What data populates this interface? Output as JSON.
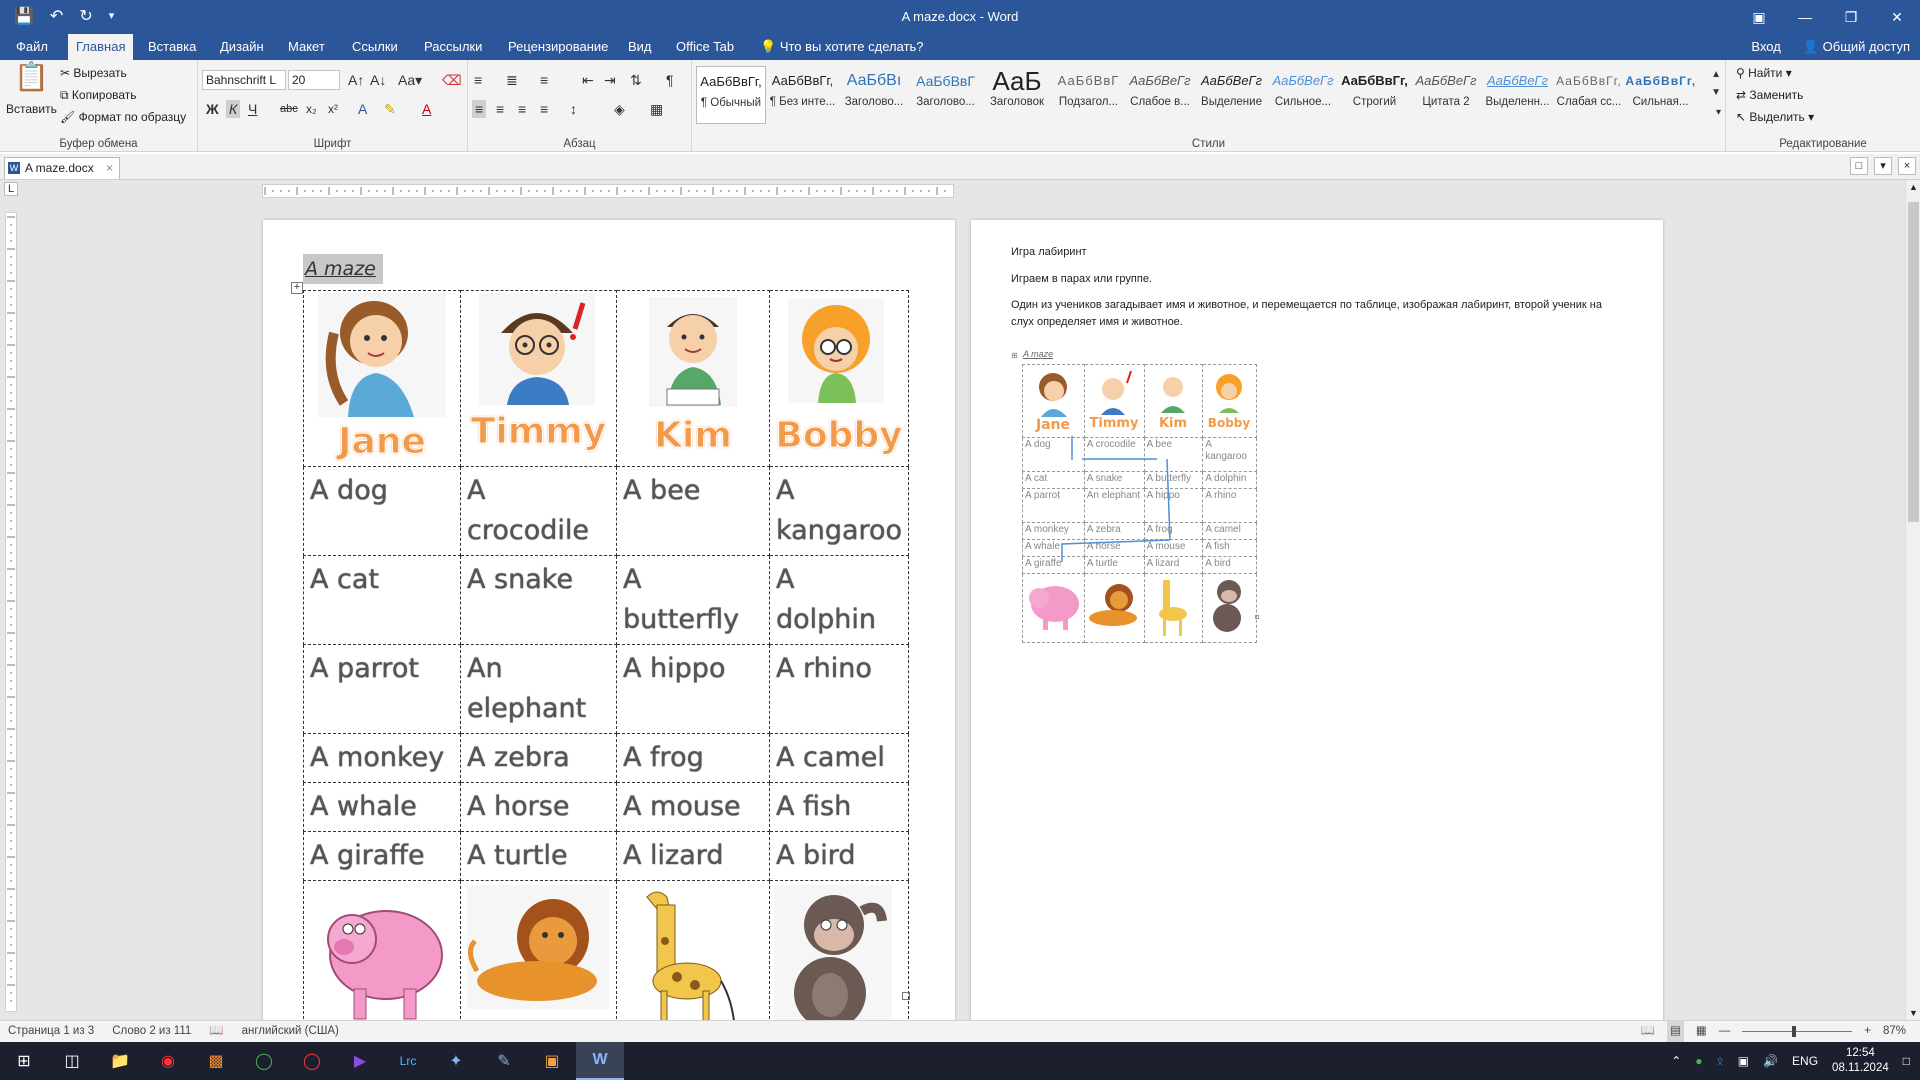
{
  "titlebar": {
    "title": "A maze.docx - Word",
    "qat": [
      "save-icon",
      "undo-icon",
      "redo-icon",
      "customize-icon"
    ]
  },
  "tabs": [
    "Файл",
    "Главная",
    "Вставка",
    "Дизайн",
    "Макет",
    "Ссылки",
    "Рассылки",
    "Рецензирование",
    "Вид",
    "Office Tab"
  ],
  "active_tab": "Главная",
  "tell_me": "Что вы хотите сделать?",
  "account": {
    "signin": "Вход",
    "share": "Общий доступ"
  },
  "ribbon": {
    "clipboard": {
      "paste": "Вставить",
      "cut": "Вырезать",
      "copy": "Копировать",
      "format_painter": "Формат по образцу",
      "label": "Буфер обмена"
    },
    "font": {
      "name": "Bahnschrift L",
      "size": "20",
      "label": "Шрифт"
    },
    "paragraph": {
      "label": "Абзац"
    },
    "styles": {
      "label": "Стили",
      "items": [
        {
          "preview": "АаБбВвГг,",
          "name": "¶ Обычный"
        },
        {
          "preview": "АаБбВвГг,",
          "name": "¶ Без инте..."
        },
        {
          "preview": "АаБбВı",
          "name": "Заголово..."
        },
        {
          "preview": "АаБбВвГ",
          "name": "Заголово..."
        },
        {
          "preview": "АаБ",
          "name": "Заголовок"
        },
        {
          "preview": "АаБбВвГ",
          "name": "Подзагол..."
        },
        {
          "preview": "АаБбВеГг",
          "name": "Слабое в..."
        },
        {
          "preview": "АаБбВеГг",
          "name": "Выделение"
        },
        {
          "preview": "АаБбВеГг",
          "name": "Сильное..."
        },
        {
          "preview": "АаБбВвГг,",
          "name": "Строгий"
        },
        {
          "preview": "АаБбВеГг",
          "name": "Цитата 2"
        },
        {
          "preview": "АаБбВеГг",
          "name": "Выделенн..."
        },
        {
          "preview": "АаБбВвГг,",
          "name": "Слабая сс..."
        },
        {
          "preview": "АаБбВвГг,",
          "name": "Сильная..."
        }
      ]
    },
    "editing": {
      "find": "Найти",
      "replace": "Заменить",
      "select": "Выделить",
      "label": "Редактирование"
    }
  },
  "doc_tab": "A maze.docx",
  "page1": {
    "heading": "A maze",
    "names": [
      "Jane",
      "Timmy",
      "Kim",
      "Bobby"
    ],
    "rows": [
      [
        "A dog",
        "A crocodile",
        "A bee",
        "A kangaroo"
      ],
      [
        "A cat",
        "A snake",
        "A butterfly",
        "A dolphin"
      ],
      [
        "A parrot",
        "An elephant",
        "A hippo",
        "A rhino"
      ],
      [
        "A monkey",
        "A zebra",
        "A frog",
        "A camel"
      ],
      [
        "A whale",
        "A horse",
        "A mouse",
        "A fish"
      ],
      [
        "A giraffe",
        "A turtle",
        "A lizard",
        "A bird"
      ]
    ]
  },
  "page2": {
    "line1": "Игра лабиринт",
    "line2": "Играем в парах или группе.",
    "line3": "Один из учеников загадывает имя и животное, и перемещается по таблице, изображая лабиринт, второй ученик на слух определяет имя и животное.",
    "mini_heading": "A maze"
  },
  "statusbar": {
    "page": "Страница 1 из 3",
    "words": "Слово 2 из 111",
    "lang": "английский (США)",
    "zoom": "87%"
  },
  "taskbar": {
    "lang": "ENG",
    "time": "12:54",
    "date": "08.11.2024"
  },
  "colors": {
    "accent": "#2b579a",
    "name_orange": "#f29a4c"
  }
}
